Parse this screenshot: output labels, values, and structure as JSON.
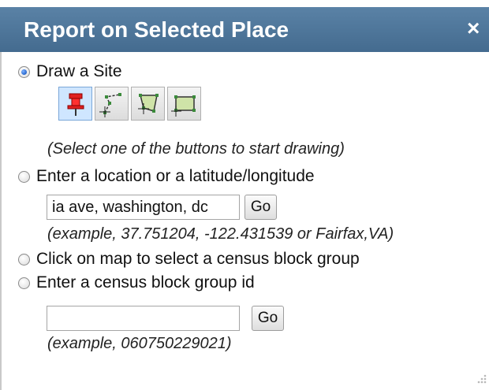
{
  "header": {
    "title": "Report on Selected Place",
    "close_glyph": "×"
  },
  "options": [
    {
      "label": "Draw a Site",
      "selected": true
    },
    {
      "label": "Enter a location or a latitude/longitude",
      "selected": false
    },
    {
      "label": "Click on map to select a census block group",
      "selected": false
    },
    {
      "label": "Enter a census block group id",
      "selected": false
    }
  ],
  "draw_tools": [
    {
      "icon": "pushpin-icon",
      "active": true
    },
    {
      "icon": "polyline-icon",
      "active": false
    },
    {
      "icon": "polygon-icon",
      "active": false
    },
    {
      "icon": "rectangle-icon",
      "active": false
    }
  ],
  "draw_hint": "(Select one of the buttons to start drawing)",
  "location": {
    "value": "ia ave, washington, dc",
    "go_label": "Go",
    "example": "(example, 37.751204, -122.431539 or Fairfax,VA)"
  },
  "block_group": {
    "value": "",
    "go_label": "Go",
    "example": "(example, 060750229021)"
  },
  "colors": {
    "titlebar": "#486f92",
    "title_text": "#ffffff",
    "active_tool": "#cfe6ff"
  }
}
